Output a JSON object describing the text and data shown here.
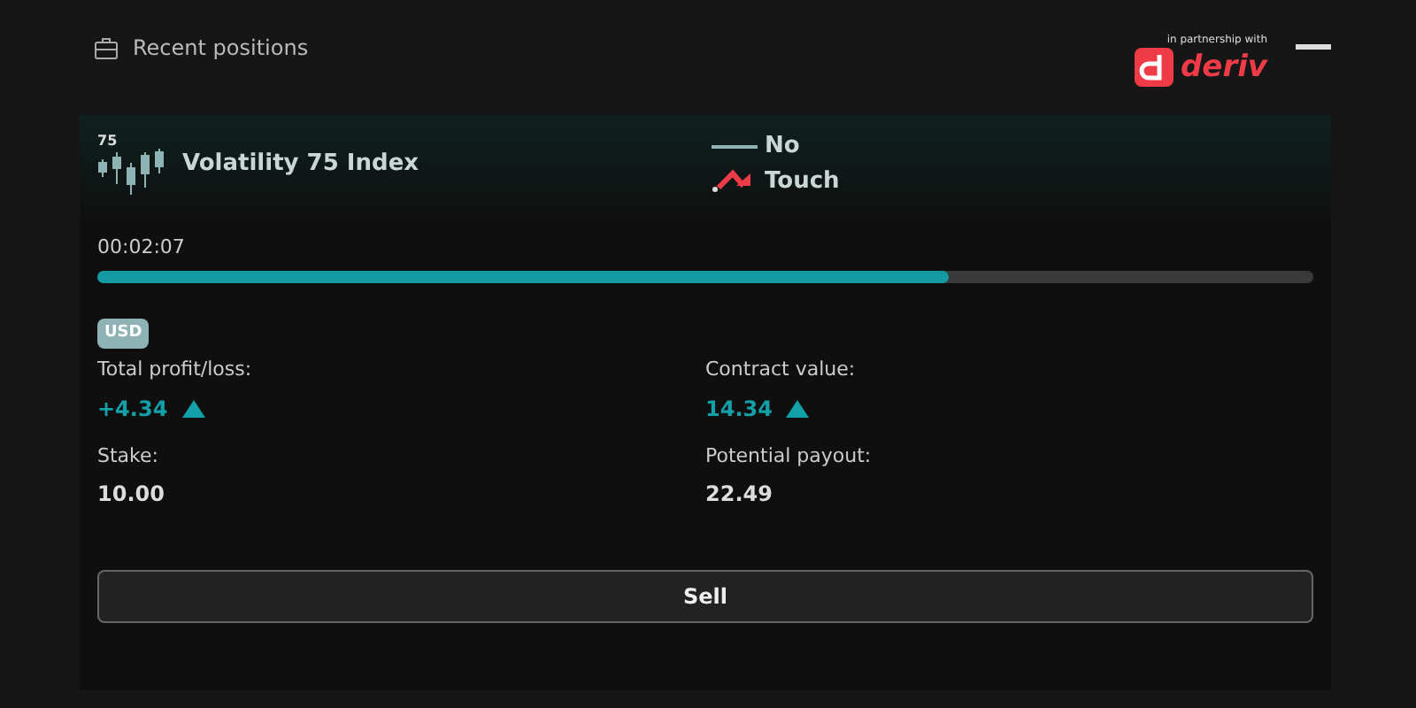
{
  "header": {
    "title": "Recent positions",
    "partner_note": "in partnership with",
    "logo_text": "deriv"
  },
  "position": {
    "market_badge": "75",
    "market": "Volatility 75 Index",
    "contract_lines": [
      {
        "kind": "barrier",
        "label": "No"
      },
      {
        "kind": "touch",
        "label": "Touch"
      }
    ],
    "timer": "00:02:07",
    "progress": {
      "level": 0.7
    },
    "currency": "USD",
    "fields": [
      {
        "label": "Total profit/loss:",
        "value": "+4.34",
        "rising": true
      },
      {
        "label": "Contract value:",
        "value": "14.34",
        "rising": true
      },
      {
        "label": "Stake:",
        "value": "10.00",
        "rising": false
      },
      {
        "label": "Potential payout:",
        "value": "22.49",
        "rising": false
      }
    ],
    "sell_button": "Sell"
  }
}
